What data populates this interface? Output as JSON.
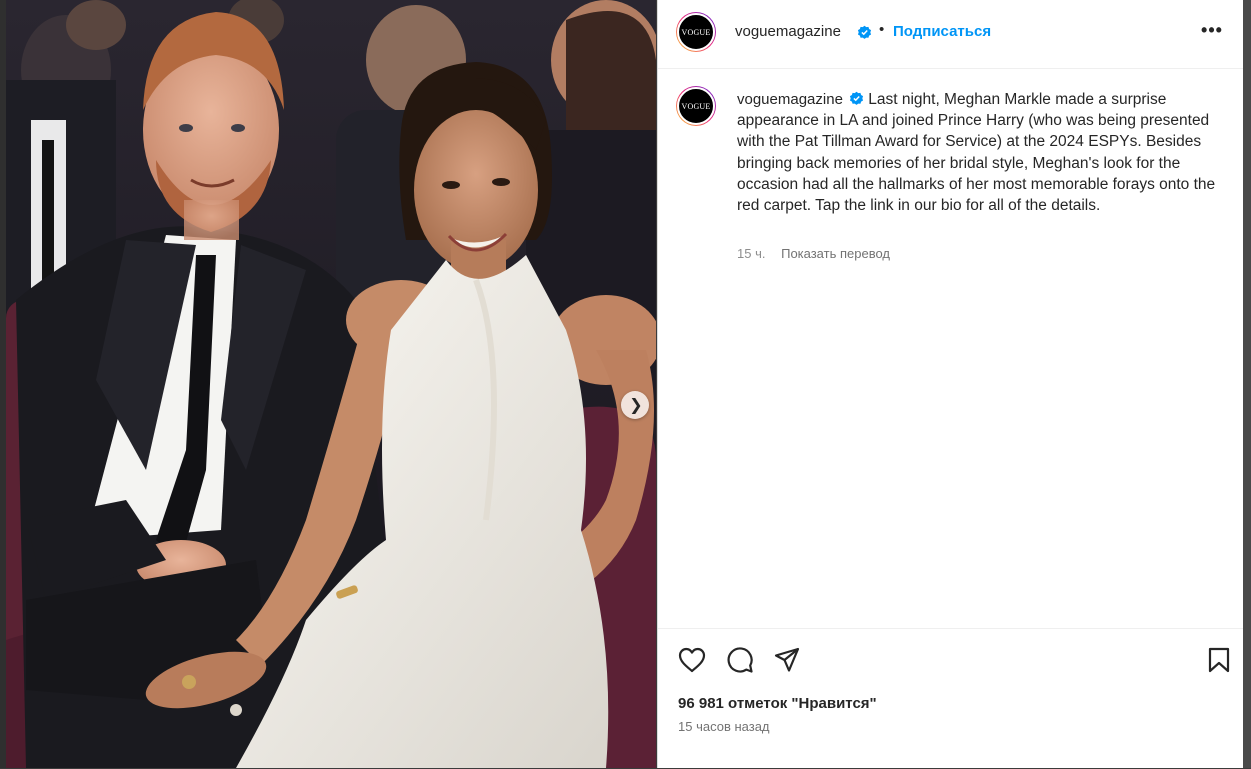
{
  "post": {
    "username": "voguemagazine",
    "avatar_text": "VOGUE",
    "follow_label": "Подписаться",
    "more_label": "•••",
    "caption": "Last night, Meghan Markle made a surprise appearance in LA and joined Prince Harry (who was being presented with the Pat Tillman Award for Service) at the 2024 ESPYs. Besides bringing back memories of her bridal style, Meghan's look for the occasion had all the hallmarks of her most memorable forays onto the red carpet. Tap the link in our bio for all of the details.",
    "caption_time": "15 ч.",
    "translate_label": "Показать перевод",
    "likes": "96 981 отметок \"Нравится\"",
    "posted_ago": "15 часов назад"
  },
  "icons": {
    "verified": "verified-badge-icon",
    "like": "heart-icon",
    "comment": "comment-icon",
    "share": "send-icon",
    "save": "bookmark-icon",
    "next": "chevron-right-icon"
  },
  "colors": {
    "link_blue": "#0095f6",
    "verified_blue": "#0095f6",
    "text": "#262626",
    "muted": "#8e8e8e"
  }
}
